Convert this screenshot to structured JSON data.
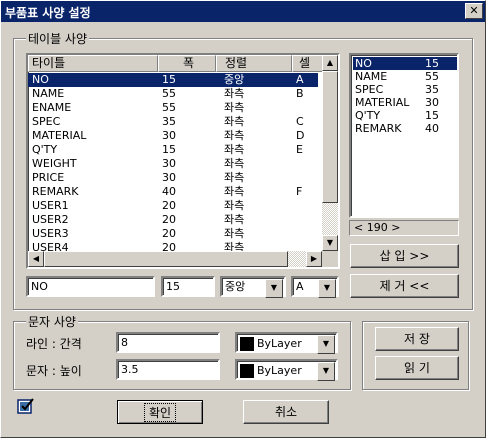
{
  "window": {
    "title": "부품표 사양 설정",
    "close_glyph": "✕"
  },
  "table_spec": {
    "group_label": "테이블 사양",
    "columns": [
      "타이틀",
      "폭",
      "정렬",
      "셀"
    ],
    "rows": [
      [
        "NO",
        "15",
        "중앙",
        "A"
      ],
      [
        "NAME",
        "55",
        "좌측",
        "B"
      ],
      [
        "ENAME",
        "55",
        "좌측",
        ""
      ],
      [
        "SPEC",
        "35",
        "좌측",
        "C"
      ],
      [
        "MATERIAL",
        "30",
        "좌측",
        "D"
      ],
      [
        "Q'TY",
        "15",
        "좌측",
        "E"
      ],
      [
        "WEIGHT",
        "30",
        "좌측",
        ""
      ],
      [
        "PRICE",
        "30",
        "좌측",
        ""
      ],
      [
        "REMARK",
        "40",
        "좌측",
        "F"
      ],
      [
        "USER1",
        "20",
        "좌측",
        ""
      ],
      [
        "USER2",
        "20",
        "좌측",
        ""
      ],
      [
        "USER3",
        "20",
        "좌측",
        ""
      ],
      [
        "USER4",
        "20",
        "좌측",
        ""
      ]
    ],
    "edit": {
      "title": "NO",
      "width": "15",
      "align": "중앙",
      "cell": "A"
    },
    "right_list": [
      [
        "NO",
        "15"
      ],
      [
        "NAME",
        "55"
      ],
      [
        "SPEC",
        "35"
      ],
      [
        "MATERIAL",
        "30"
      ],
      [
        "Q'TY",
        "15"
      ],
      [
        "REMARK",
        "40"
      ]
    ],
    "total": "< 190 >",
    "insert_label": "삽 입 >>",
    "remove_label": "제 거 <<"
  },
  "text_spec": {
    "group_label": "문자 사양",
    "line_gap_label": "라인 : 간격",
    "line_gap_value": "8",
    "text_height_label": "문자 : 높이",
    "text_height_value": "3.5",
    "layer1": "ByLayer",
    "layer2": "ByLayer"
  },
  "side_buttons": {
    "save": "저 장",
    "read": "읽 기"
  },
  "footer": {
    "ok": "확인",
    "cancel": "취소"
  }
}
